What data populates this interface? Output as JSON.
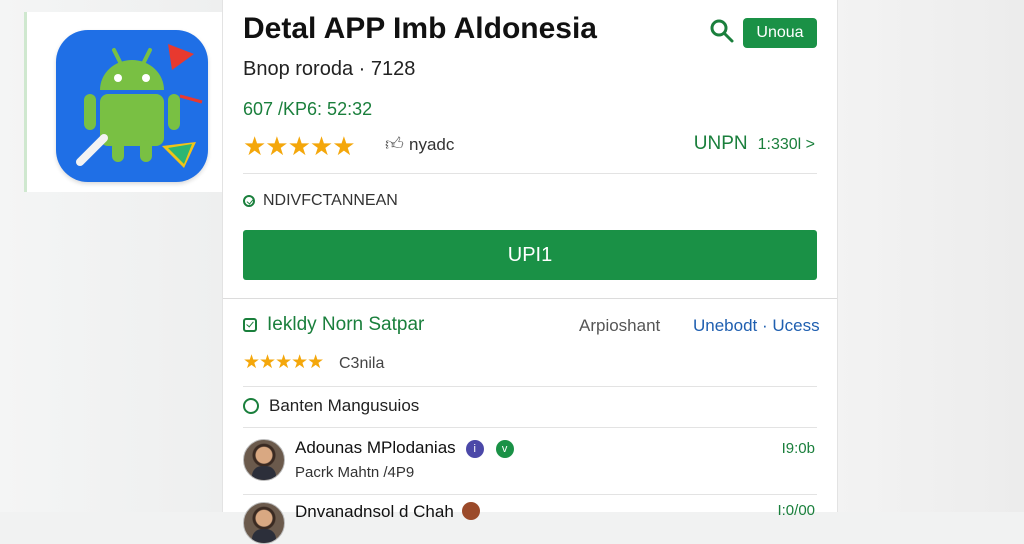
{
  "header": {
    "app_title": "Detal APP Imb Aldonesia",
    "top_button": "Unoua",
    "developer_line": "Bnop roroda · 7128",
    "meta_line": "607 /KP6: 52:32"
  },
  "rating": {
    "stars": "★★★★★",
    "value": 5,
    "max": 5,
    "label": "nyadc"
  },
  "right_link": {
    "label": "UNPN",
    "count": "1:330l >"
  },
  "verified": {
    "label": "NDIVFCTANNEAN"
  },
  "main_button": {
    "label": "UPI1"
  },
  "section": {
    "title": "Iekldy Norn Satpar",
    "middle_text": "Arpioshant",
    "link_text": "Unebodt · Ucess",
    "stars": "★★★★★",
    "rating_value": 4.5,
    "rating_label": "C3nila"
  },
  "language_row": {
    "label": "Banten Mangusuios"
  },
  "review": {
    "name": "Adounas MPlodanias",
    "badge_a": "i",
    "badge_b": "v",
    "subtext": "Pacrk Mahtn /4P9",
    "time": "I9:0b"
  },
  "review_peek": {
    "name": "Dnvanadnsol d Chah",
    "time": "I:0/00"
  },
  "colors": {
    "accent_green": "#1a9146",
    "star_orange": "#f4a70b",
    "link_blue": "#1f5fb0",
    "icon_blue": "#1f6fe6",
    "android_green": "#79c043"
  },
  "icons": [
    "android-app-icon",
    "search-icon",
    "thumbs-up-icon",
    "verified-check-icon",
    "checkbox-icon",
    "radio-ring-icon",
    "avatar"
  ]
}
